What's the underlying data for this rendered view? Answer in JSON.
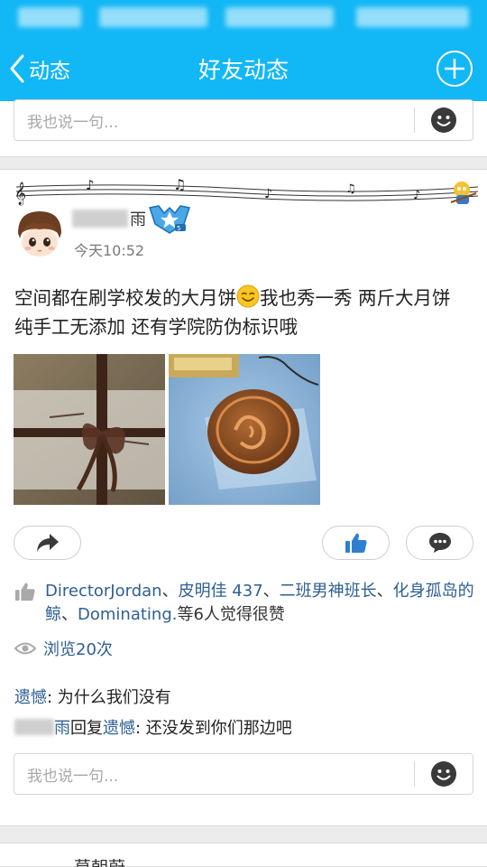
{
  "nav": {
    "back_label": "动态",
    "title": "好友动态"
  },
  "top_card": {
    "comment_placeholder": "我也说一句..."
  },
  "post": {
    "author_name_visible": "雨",
    "time": "今天10:52",
    "text_before_emoji": "空间都在刷学校发的大月饼",
    "text_after_emoji": "我也秀一秀 两斤大月饼 纯手工无添加 还有学院防伪标识哦",
    "likes": {
      "users": [
        "DirectorJordan",
        "皮明佳 437",
        "二班男神班长",
        "化身孤岛的鲸",
        "Dominating."
      ],
      "separator": "、",
      "suffix": "等6人觉得很赞"
    },
    "views": "浏览20次",
    "comments": [
      {
        "author": "遗憾",
        "text": ": 为什么我们没有"
      },
      {
        "author_visible": "雨",
        "reply_word": "回复",
        "target": "遗憾",
        "text": ": 还没发到你们那边吧"
      }
    ],
    "comment_placeholder": "我也说一句..."
  },
  "next_card": {
    "name": "莫朝蔚"
  },
  "colors": {
    "header": "#12b7f5",
    "link": "#2d5f94",
    "background": "#ececec"
  },
  "icons": [
    "back-arrow-icon",
    "add-icon",
    "emoji-icon",
    "share-icon",
    "like-icon",
    "reply-icon",
    "thumb-icon",
    "eye-icon",
    "vip-badge-icon",
    "smile-emoji-icon"
  ]
}
